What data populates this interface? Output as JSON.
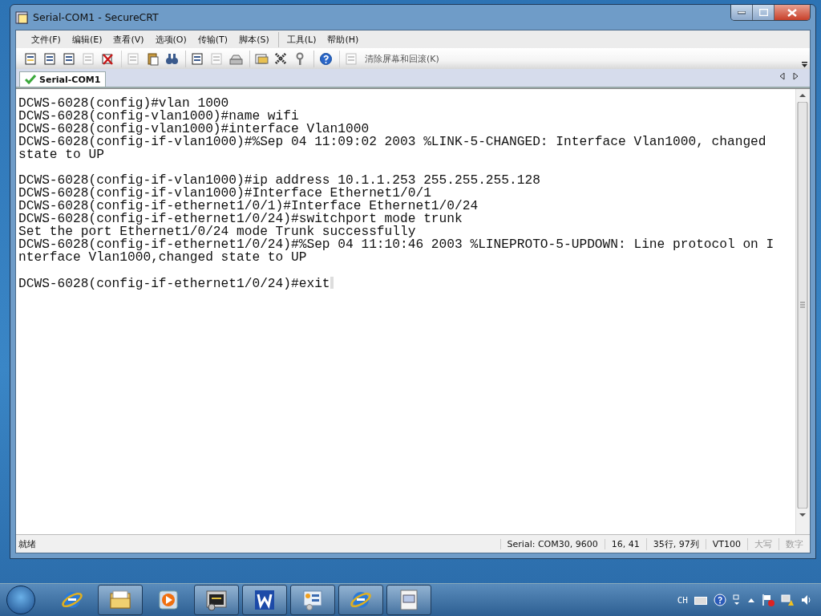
{
  "window": {
    "title": "Serial-COM1 - SecureCRT"
  },
  "menu": [
    {
      "label": "文件(F)",
      "separator_before": false
    },
    {
      "label": "编辑(E)",
      "separator_before": false
    },
    {
      "label": "查看(V)",
      "separator_before": false
    },
    {
      "label": "选项(O)",
      "separator_before": false
    },
    {
      "label": "传输(T)",
      "separator_before": false
    },
    {
      "label": "脚本(S)",
      "separator_before": false
    },
    {
      "label": "工具(L)",
      "separator_before": true
    },
    {
      "label": "帮助(H)",
      "separator_before": false
    }
  ],
  "toolbar": [
    {
      "disabled": false,
      "separator_before": false
    },
    {
      "disabled": false,
      "separator_before": false
    },
    {
      "disabled": false,
      "separator_before": false
    },
    {
      "disabled": true,
      "separator_before": false
    },
    {
      "disabled": false,
      "separator_before": false
    },
    {
      "disabled": true,
      "separator_before": true
    },
    {
      "disabled": false,
      "separator_before": false
    },
    {
      "disabled": false,
      "separator_before": false
    },
    {
      "disabled": false,
      "separator_before": true
    },
    {
      "disabled": true,
      "separator_before": false
    },
    {
      "disabled": false,
      "separator_before": false
    },
    {
      "disabled": false,
      "separator_before": true
    },
    {
      "disabled": false,
      "separator_before": false
    },
    {
      "disabled": false,
      "separator_before": false
    },
    {
      "disabled": false,
      "separator_before": true
    },
    {
      "disabled": true,
      "separator_before": true,
      "label": "清除屏幕和回滚(K)"
    }
  ],
  "tabs": [
    {
      "label": "Serial-COM1",
      "selected": true,
      "connected": true
    }
  ],
  "terminal": {
    "blocks": [
      [
        "DCWS-6028(config)#vlan 1000",
        "DCWS-6028(config-vlan1000)#name wifi",
        "DCWS-6028(config-vlan1000)#interface Vlan1000",
        "DCWS-6028(config-if-vlan1000)#%Sep 04 11:09:02 2003 %LINK-5-CHANGED: Interface Vlan1000, changed",
        "state to UP"
      ],
      [
        "DCWS-6028(config-if-vlan1000)#ip address 10.1.1.253 255.255.255.128",
        "DCWS-6028(config-if-vlan1000)#Interface Ethernet1/0/1",
        "DCWS-6028(config-if-ethernet1/0/1)#Interface Ethernet1/0/24",
        "DCWS-6028(config-if-ethernet1/0/24)#switchport mode trunk",
        "Set the port Ethernet1/0/24 mode Trunk successfully",
        "DCWS-6028(config-if-ethernet1/0/24)#%Sep 04 11:10:46 2003 %LINEPROTO-5-UPDOWN: Line protocol on I",
        "nterface Vlan1000,changed state to UP"
      ],
      [
        "DCWS-6028(config-if-ethernet1/0/24)#exit"
      ]
    ]
  },
  "status_bar": [
    {
      "text": "就绪",
      "disabled": false
    },
    {
      "text": "Serial: COM30, 9600",
      "disabled": false
    },
    {
      "text": "16,  41",
      "disabled": false
    },
    {
      "text": "35行, 97列",
      "disabled": false
    },
    {
      "text": "VT100",
      "disabled": false
    },
    {
      "text": "大写",
      "disabled": true
    },
    {
      "text": "数字",
      "disabled": true
    }
  ],
  "taskbar": {
    "apps": [
      {
        "open": false
      },
      {
        "open": true
      },
      {
        "open": false
      },
      {
        "open": true
      },
      {
        "open": true
      },
      {
        "open": true
      },
      {
        "open": true
      },
      {
        "open": true
      }
    ],
    "tray_language": "CH"
  }
}
